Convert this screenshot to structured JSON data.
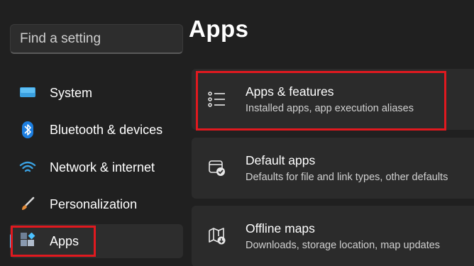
{
  "search": {
    "placeholder": "Find a setting"
  },
  "sidebar": {
    "items": [
      {
        "label": "System",
        "icon": "monitor-icon"
      },
      {
        "label": "Bluetooth & devices",
        "icon": "bluetooth-icon"
      },
      {
        "label": "Network & internet",
        "icon": "wifi-icon"
      },
      {
        "label": "Personalization",
        "icon": "brush-icon"
      },
      {
        "label": "Apps",
        "icon": "apps-icon",
        "selected": true
      }
    ]
  },
  "main": {
    "title": "Apps",
    "cards": [
      {
        "title": "Apps & features",
        "subtitle": "Installed apps, app execution aliases",
        "icon": "list-icon"
      },
      {
        "title": "Default apps",
        "subtitle": "Defaults for file and link types, other defaults",
        "icon": "default-apps-icon"
      },
      {
        "title": "Offline maps",
        "subtitle": "Downloads, storage location, map updates",
        "icon": "map-icon"
      }
    ]
  },
  "colors": {
    "background": "#202020",
    "card": "#2b2b2b",
    "accent": "#4cc2ff",
    "highlight": "#e0191f"
  }
}
